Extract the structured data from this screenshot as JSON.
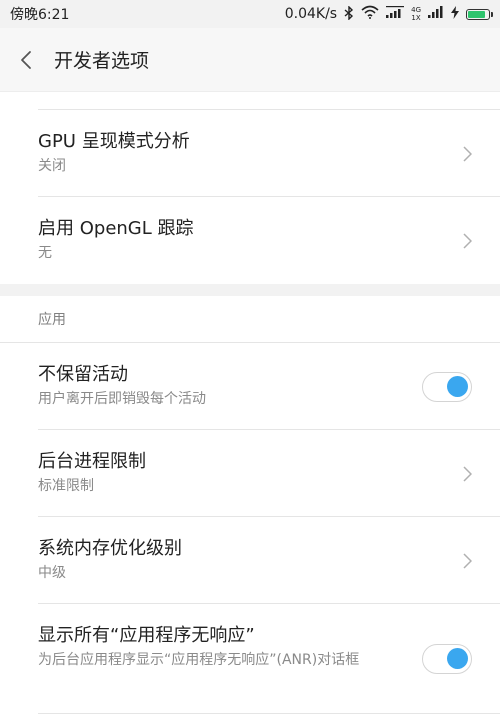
{
  "status_bar": {
    "time": "傍晚6:21",
    "speed": "0.04K/s",
    "network_top": "4G",
    "network_bottom": "1X",
    "battery_level": 0.85
  },
  "header": {
    "title": "开发者选项"
  },
  "top_rows": [
    {
      "title": "GPU 呈现模式分析",
      "subtitle": "关闭"
    },
    {
      "title": "启用 OpenGL 跟踪",
      "subtitle": "无"
    }
  ],
  "section": {
    "label": "应用"
  },
  "app_rows": [
    {
      "title": "不保留活动",
      "subtitle": "用户离开后即销毁每个活动",
      "control": "toggle",
      "on": true
    },
    {
      "title": "后台进程限制",
      "subtitle": "标准限制",
      "control": "chevron"
    },
    {
      "title": "系统内存优化级别",
      "subtitle": "中级",
      "control": "chevron"
    },
    {
      "title": "显示所有“应用程序无响应”",
      "subtitle": "为后台应用程序显示“应用程序无响应”(ANR)对话框",
      "control": "toggle",
      "on": true
    }
  ],
  "colors": {
    "accent": "#3aa7ef",
    "battery": "#2ec46d"
  }
}
